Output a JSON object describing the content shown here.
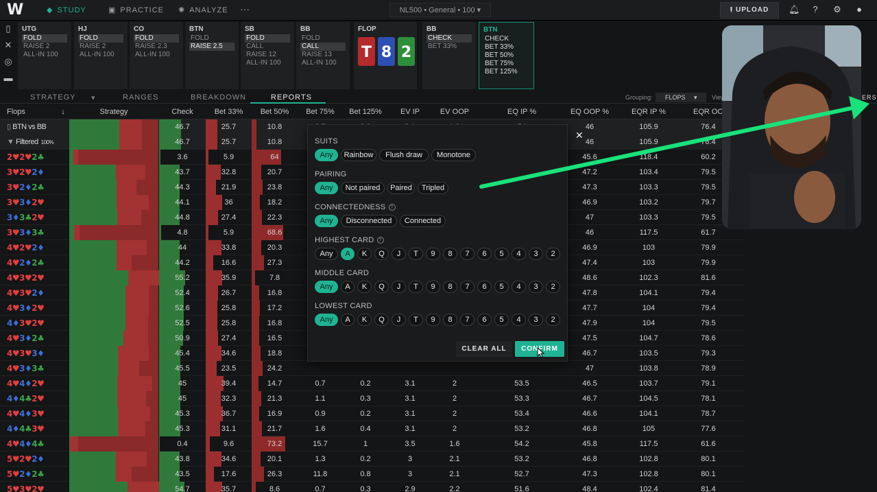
{
  "nav": {
    "logo": "W",
    "study": "STUDY",
    "practice": "PRACTICE",
    "analyze": "ANALYZE",
    "more": "···",
    "game": "NL500 • General • 100",
    "upload": "UPLOAD"
  },
  "colors": {
    "accent": "#1fb393",
    "heart": "#e04040",
    "club": "#3aa04a",
    "diamond": "#3a6fd8",
    "spade": "#aaaaaa"
  },
  "positions": [
    {
      "name": "UTG",
      "options": [
        {
          "t": "FOLD",
          "sel": true
        },
        {
          "t": "RAISE 2"
        },
        {
          "t": "ALL-IN 100"
        }
      ]
    },
    {
      "name": "HJ",
      "options": [
        {
          "t": "FOLD",
          "sel": true
        },
        {
          "t": "RAISE 2"
        },
        {
          "t": "ALL-IN 100"
        }
      ]
    },
    {
      "name": "CO",
      "options": [
        {
          "t": "FOLD",
          "sel": true
        },
        {
          "t": "RAISE 2.3"
        },
        {
          "t": "ALL-IN 100"
        }
      ]
    },
    {
      "name": "BTN",
      "options": [
        {
          "t": "FOLD"
        },
        {
          "t": "RAISE 2.5",
          "sel": true
        }
      ]
    },
    {
      "name": "SB",
      "options": [
        {
          "t": "FOLD",
          "sel": true
        },
        {
          "t": "CALL"
        },
        {
          "t": "RAISE 12"
        },
        {
          "t": "ALL-IN 100"
        }
      ]
    },
    {
      "name": "BB",
      "options": [
        {
          "t": "FOLD"
        },
        {
          "t": "CALL",
          "sel": true
        },
        {
          "t": "RAISE 13"
        },
        {
          "t": "ALL-IN 100"
        }
      ]
    }
  ],
  "flop": {
    "label": "FLOP",
    "cards": [
      {
        "r": "T",
        "c": "#b52a2a"
      },
      {
        "r": "8",
        "c": "#2d4fb3"
      },
      {
        "r": "2",
        "c": "#2e8f3a"
      }
    ]
  },
  "bb_after": {
    "name": "BB",
    "options": [
      {
        "t": "CHECK",
        "sel": true
      },
      {
        "t": "BET 33%"
      }
    ]
  },
  "btn_after": {
    "name": "BTN",
    "options": [
      "CHECK",
      "BET 33%",
      "BET 50%",
      "BET 75%",
      "BET 125%"
    ]
  },
  "subtabs": {
    "strategy": "STRATEGY",
    "ranges": "RANGES",
    "breakdown": "BREAKDOWN",
    "reports": "REPORTS",
    "grouping_label": "Grouping:",
    "grouping_value": "FLOPS",
    "view_label": "View",
    "filters": "ERS"
  },
  "columns": [
    "Flops",
    "Strategy",
    "Check",
    "Bet 33%",
    "Bet 50%",
    "Bet 75%",
    "Bet 125%",
    "EV IP",
    "EV OOP",
    "EQ IP %",
    "EQ OOP %",
    "EQR IP %",
    "EQR OO"
  ],
  "summary_rows": [
    {
      "label": "BTN vs BB",
      "vals": [
        "46.7",
        "25.7",
        "10.8",
        "8.5",
        "8.3",
        "3.1",
        "1.9",
        "54",
        "46",
        "105.9",
        "76.4"
      ]
    },
    {
      "label": "Filtered",
      "badge": "100%",
      "vals": [
        "46.7",
        "25.7",
        "10.8",
        "",
        "",
        "",
        "",
        "",
        "46",
        "105.9",
        "76.4"
      ]
    }
  ],
  "rows": [
    {
      "flop": [
        [
          "2",
          "h"
        ],
        [
          "2",
          "h"
        ],
        [
          "2",
          "c"
        ]
      ],
      "vals": [
        "3.6",
        "5.9",
        "64",
        "",
        "",
        "",
        "",
        "",
        "45.6",
        "118.4",
        "60.2"
      ]
    },
    {
      "flop": [
        [
          "3",
          "h"
        ],
        [
          "2",
          "h"
        ],
        [
          "2",
          "d"
        ]
      ],
      "vals": [
        "43.7",
        "32.8",
        "20.7",
        "",
        "",
        "",
        "",
        "",
        "47.2",
        "103.4",
        "79.5"
      ]
    },
    {
      "flop": [
        [
          "3",
          "h"
        ],
        [
          "2",
          "d"
        ],
        [
          "2",
          "c"
        ]
      ],
      "vals": [
        "44.3",
        "21.9",
        "23.8",
        "",
        "",
        "",
        "",
        "",
        "47.3",
        "103.3",
        "79.5"
      ]
    },
    {
      "flop": [
        [
          "3",
          "h"
        ],
        [
          "3",
          "d"
        ],
        [
          "2",
          "h"
        ]
      ],
      "vals": [
        "44.1",
        "36",
        "18.2",
        "",
        "",
        "",
        "",
        "",
        "46.9",
        "103.2",
        "79.7"
      ]
    },
    {
      "flop": [
        [
          "3",
          "d"
        ],
        [
          "3",
          "c"
        ],
        [
          "2",
          "h"
        ]
      ],
      "vals": [
        "44.8",
        "27.4",
        "22.3",
        "",
        "",
        "",
        "",
        "",
        "47",
        "103.3",
        "79.5"
      ]
    },
    {
      "flop": [
        [
          "3",
          "h"
        ],
        [
          "3",
          "d"
        ],
        [
          "3",
          "c"
        ]
      ],
      "vals": [
        "4.8",
        "5.9",
        "68.6",
        "",
        "",
        "",
        "",
        "",
        "46",
        "117.5",
        "61.7"
      ]
    },
    {
      "flop": [
        [
          "4",
          "h"
        ],
        [
          "2",
          "h"
        ],
        [
          "2",
          "d"
        ]
      ],
      "vals": [
        "44",
        "33.8",
        "20.3",
        "",
        "",
        "",
        "",
        "",
        "46.9",
        "103",
        "79.9"
      ]
    },
    {
      "flop": [
        [
          "4",
          "h"
        ],
        [
          "2",
          "d"
        ],
        [
          "2",
          "c"
        ]
      ],
      "vals": [
        "44.2",
        "16.6",
        "27.3",
        "",
        "",
        "",
        "",
        "",
        "47.4",
        "103",
        "79.9"
      ]
    },
    {
      "flop": [
        [
          "4",
          "h"
        ],
        [
          "3",
          "h"
        ],
        [
          "2",
          "h"
        ]
      ],
      "vals": [
        "55.2",
        "35.9",
        "7.8",
        "",
        "",
        "",
        "",
        "",
        "48.6",
        "102.3",
        "81.6"
      ]
    },
    {
      "flop": [
        [
          "4",
          "h"
        ],
        [
          "3",
          "h"
        ],
        [
          "2",
          "d"
        ]
      ],
      "vals": [
        "52.4",
        "26.7",
        "16.8",
        "",
        "",
        "",
        "",
        "",
        "47.8",
        "104.1",
        "79.4"
      ]
    },
    {
      "flop": [
        [
          "4",
          "h"
        ],
        [
          "3",
          "d"
        ],
        [
          "2",
          "h"
        ]
      ],
      "vals": [
        "52.6",
        "25.8",
        "17.2",
        "",
        "",
        "",
        "",
        "",
        "47.7",
        "104",
        "79.4"
      ]
    },
    {
      "flop": [
        [
          "4",
          "d"
        ],
        [
          "3",
          "h"
        ],
        [
          "2",
          "h"
        ]
      ],
      "vals": [
        "52.5",
        "25.8",
        "16.8",
        "",
        "",
        "",
        "",
        "",
        "47.9",
        "104",
        "79.5"
      ]
    },
    {
      "flop": [
        [
          "4",
          "h"
        ],
        [
          "3",
          "d"
        ],
        [
          "2",
          "c"
        ]
      ],
      "vals": [
        "50.9",
        "27.4",
        "16.5",
        "",
        "",
        "",
        "",
        "",
        "47.5",
        "104.7",
        "78.6"
      ]
    },
    {
      "flop": [
        [
          "4",
          "h"
        ],
        [
          "3",
          "h"
        ],
        [
          "3",
          "d"
        ]
      ],
      "vals": [
        "45.4",
        "34.6",
        "18.8",
        "",
        "",
        "",
        "",
        "",
        "46.7",
        "103.5",
        "79.3"
      ]
    },
    {
      "flop": [
        [
          "4",
          "h"
        ],
        [
          "3",
          "d"
        ],
        [
          "3",
          "c"
        ]
      ],
      "vals": [
        "45.5",
        "23.5",
        "24.2",
        "",
        "",
        "",
        "",
        "",
        "47",
        "103.8",
        "78.9"
      ]
    },
    {
      "flop": [
        [
          "4",
          "h"
        ],
        [
          "4",
          "d"
        ],
        [
          "2",
          "h"
        ]
      ],
      "vals": [
        "45",
        "39.4",
        "14.7",
        "0.7",
        "0.2",
        "3.1",
        "2",
        "53.5",
        "46.5",
        "103.7",
        "79.1"
      ]
    },
    {
      "flop": [
        [
          "4",
          "d"
        ],
        [
          "4",
          "c"
        ],
        [
          "2",
          "h"
        ]
      ],
      "vals": [
        "45",
        "32.3",
        "21.3",
        "1.1",
        "0.3",
        "3.1",
        "2",
        "53.3",
        "46.7",
        "104.5",
        "78.1"
      ]
    },
    {
      "flop": [
        [
          "4",
          "h"
        ],
        [
          "4",
          "d"
        ],
        [
          "3",
          "h"
        ]
      ],
      "vals": [
        "45.3",
        "36.7",
        "16.9",
        "0.9",
        "0.2",
        "3.1",
        "2",
        "53.4",
        "46.6",
        "104.1",
        "78.7"
      ]
    },
    {
      "flop": [
        [
          "4",
          "d"
        ],
        [
          "4",
          "c"
        ],
        [
          "3",
          "h"
        ]
      ],
      "vals": [
        "45.3",
        "31.1",
        "21.7",
        "1.6",
        "0.4",
        "3.1",
        "2",
        "53.2",
        "46.8",
        "105",
        "77.6"
      ]
    },
    {
      "flop": [
        [
          "4",
          "h"
        ],
        [
          "4",
          "d"
        ],
        [
          "4",
          "c"
        ]
      ],
      "vals": [
        "0.4",
        "9.6",
        "73.2",
        "15.7",
        "1",
        "3.5",
        "1.6",
        "54.2",
        "45.8",
        "117.5",
        "61.6"
      ]
    },
    {
      "flop": [
        [
          "5",
          "h"
        ],
        [
          "2",
          "h"
        ],
        [
          "2",
          "d"
        ]
      ],
      "vals": [
        "43.8",
        "34.6",
        "20.1",
        "1.3",
        "0.2",
        "3",
        "2.1",
        "53.2",
        "46.8",
        "102.8",
        "80.1"
      ]
    },
    {
      "flop": [
        [
          "5",
          "h"
        ],
        [
          "2",
          "d"
        ],
        [
          "2",
          "c"
        ]
      ],
      "vals": [
        "43.5",
        "17.6",
        "26.3",
        "11.8",
        "0.8",
        "3",
        "2.1",
        "52.7",
        "47.3",
        "102.8",
        "80.1"
      ]
    },
    {
      "flop": [
        [
          "5",
          "h"
        ],
        [
          "3",
          "h"
        ],
        [
          "2",
          "h"
        ]
      ],
      "vals": [
        "54.7",
        "35.7",
        "8.6",
        "0.7",
        "0.3",
        "2.9",
        "2.2",
        "51.6",
        "48.4",
        "102.4",
        "81.4"
      ]
    }
  ],
  "popup": {
    "close": "✕",
    "suits_label": "SUITS",
    "suits": [
      "Any",
      "Rainbow",
      "Flush draw",
      "Monotone"
    ],
    "pairing_label": "PAIRING",
    "pairing": [
      "Any",
      "Not paired",
      "Paired",
      "Tripled"
    ],
    "connected_label": "CONNECTEDNESS",
    "connected": [
      "Any",
      "Disconnected",
      "Connected"
    ],
    "help": "?",
    "highest_label": "HIGHEST CARD",
    "middle_label": "MIDDLE CARD",
    "lowest_label": "LOWEST CARD",
    "ranks": [
      "Any",
      "A",
      "K",
      "Q",
      "J",
      "T",
      "9",
      "8",
      "7",
      "6",
      "5",
      "4",
      "3",
      "2"
    ],
    "clear": "CLEAR ALL",
    "confirm": "CONFIRM"
  }
}
